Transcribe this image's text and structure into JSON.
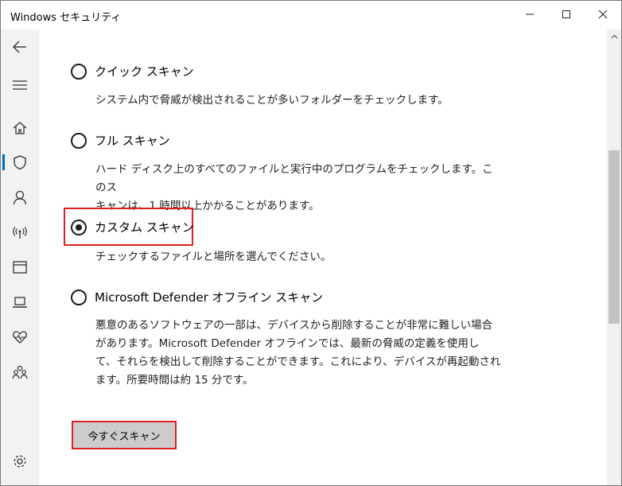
{
  "window": {
    "title": "Windows セキュリティ"
  },
  "sidebar": {
    "items": [
      {
        "icon": "back-arrow-icon"
      },
      {
        "icon": "hamburger-menu-icon"
      },
      {
        "icon": "home-icon"
      },
      {
        "icon": "shield-icon",
        "active": true
      },
      {
        "icon": "person-icon"
      },
      {
        "icon": "wireless-icon"
      },
      {
        "icon": "app-browser-icon"
      },
      {
        "icon": "laptop-icon"
      },
      {
        "icon": "heart-health-icon"
      },
      {
        "icon": "family-icon"
      },
      {
        "icon": "gear-icon"
      }
    ]
  },
  "scan": {
    "options": [
      {
        "label": "クイック スキャン",
        "selected": false,
        "description": [
          "システム内で脅威が検出されることが多いフォルダーをチェックします。"
        ]
      },
      {
        "label": "フル スキャン",
        "selected": false,
        "description": [
          "ハード ディスク上のすべてのファイルと実行中のプログラムをチェックします。このス",
          "キャンは、1 時間以上かかることがあります。"
        ]
      },
      {
        "label": "カスタム スキャン",
        "selected": true,
        "description": [
          "チェックするファイルと場所を選んでください。"
        ]
      },
      {
        "label": "Microsoft Defender オフライン スキャン",
        "selected": false,
        "description": [
          "悪意のあるソフトウェアの一部は、デバイスから削除することが非常に難しい場合",
          "があります。Microsoft Defender オフラインでは、最新の脅威の定義を使用し",
          "て、それらを検出して削除することができます。これにより、デバイスが再起動され",
          "ます。所要時間は約 15 分です。"
        ]
      }
    ],
    "button_label": "今すぐスキャン"
  },
  "colors": {
    "highlight": "#e02020",
    "accent": "#0067c0"
  }
}
